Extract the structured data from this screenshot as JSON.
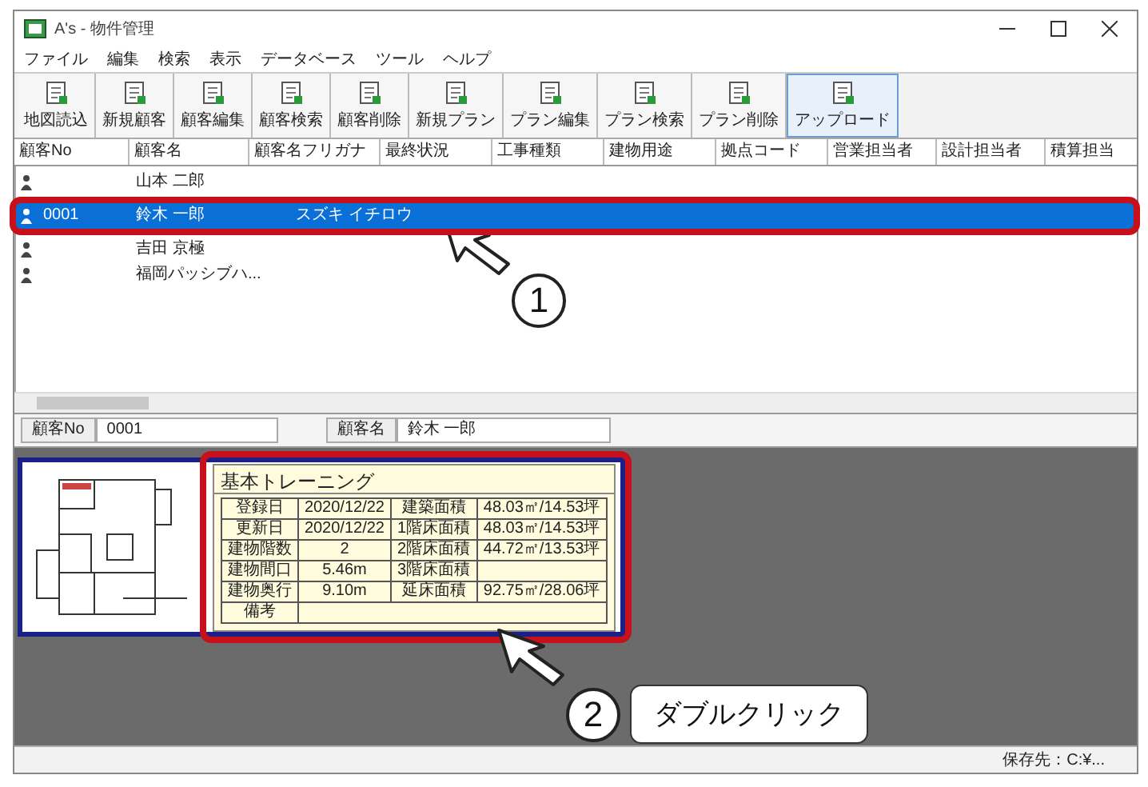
{
  "window": {
    "title": "A's - 物件管理"
  },
  "menu": [
    "ファイル",
    "編集",
    "検索",
    "表示",
    "データベース",
    "ツール",
    "ヘルプ"
  ],
  "toolbar": [
    {
      "label": "地図読込"
    },
    {
      "label": "新規顧客"
    },
    {
      "label": "顧客編集"
    },
    {
      "label": "顧客検索"
    },
    {
      "label": "顧客削除"
    },
    {
      "label": "新規プラン"
    },
    {
      "label": "プラン編集"
    },
    {
      "label": "プラン検索"
    },
    {
      "label": "プラン削除"
    },
    {
      "label": "アップロード"
    }
  ],
  "table": {
    "columns": [
      "顧客No",
      "顧客名",
      "顧客名フリガナ",
      "最終状況",
      "工事種類",
      "建物用途",
      "拠点コード",
      "営業担当者",
      "設計担当者",
      "積算担当"
    ],
    "rows": [
      {
        "no": "",
        "name": "山本 二郎",
        "kana": "",
        "selected": false
      },
      {
        "no": "0001",
        "name": "鈴木 一郎",
        "kana": "スズキ イチロウ",
        "selected": true
      },
      {
        "no": "",
        "name": "吉田 京極",
        "kana": "",
        "selected": false
      },
      {
        "no": "",
        "name": "福岡パッシブハ...",
        "kana": "",
        "selected": false
      }
    ]
  },
  "info_bar": {
    "no_label": "顧客No",
    "no_value": "0001",
    "name_label": "顧客名",
    "name_value": "鈴木 一郎"
  },
  "plan_card": {
    "title": "基本トレーニング",
    "rows": [
      {
        "label": "登録日",
        "value": "2020/12/22",
        "label2": "建築面積",
        "value2": "48.03㎡/14.53坪"
      },
      {
        "label": "更新日",
        "value": "2020/12/22",
        "label2": "1階床面積",
        "value2": "48.03㎡/14.53坪"
      },
      {
        "label": "建物階数",
        "value": "2",
        "label2": "2階床面積",
        "value2": "44.72㎡/13.53坪"
      },
      {
        "label": "建物間口",
        "value": "5.46m",
        "label2": "3階床面積"
      },
      {
        "label": "建物奥行",
        "value": "9.10m",
        "label2": "延床面積",
        "value2": "92.75㎡/28.06坪"
      },
      {
        "label": "備考"
      }
    ]
  },
  "status_bar": {
    "text": "保存先：C:¥..."
  },
  "annotations": [
    {
      "number": "1"
    },
    {
      "number": "2",
      "label": "ダブルクリック"
    }
  ]
}
